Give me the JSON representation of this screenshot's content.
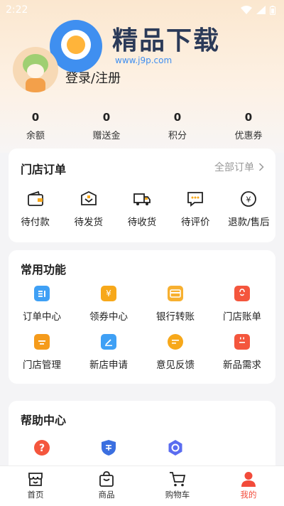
{
  "status_bar": {
    "time": "2:22"
  },
  "watermark": {
    "title": "精品下载",
    "url": "www.j9p.com"
  },
  "profile": {
    "login_label": "登录/注册"
  },
  "stats": [
    {
      "value": "0",
      "label": "余额"
    },
    {
      "value": "0",
      "label": "赠送金"
    },
    {
      "value": "0",
      "label": "积分"
    },
    {
      "value": "0",
      "label": "优惠券"
    }
  ],
  "orders": {
    "title": "门店订单",
    "view_all": "全部订单",
    "items": [
      {
        "label": "待付款",
        "icon": "wallet-icon"
      },
      {
        "label": "待发货",
        "icon": "package-icon"
      },
      {
        "label": "待收货",
        "icon": "truck-icon"
      },
      {
        "label": "待评价",
        "icon": "comment-icon"
      },
      {
        "label": "退款/售后",
        "icon": "refund-icon"
      }
    ]
  },
  "functions": {
    "title": "常用功能",
    "items": [
      {
        "label": "订单中心",
        "icon": "order-list-icon",
        "color": "#3fa0f5"
      },
      {
        "label": "领券中心",
        "icon": "coupon-icon",
        "color": "#f7a81a"
      },
      {
        "label": "银行转账",
        "icon": "bank-card-icon",
        "color": "#f7b030"
      },
      {
        "label": "门店账单",
        "icon": "shopping-bag-icon",
        "color": "#f4563d"
      },
      {
        "label": "门店管理",
        "icon": "store-icon",
        "color": "#f59b1b"
      },
      {
        "label": "新店申请",
        "icon": "edit-icon",
        "color": "#3fa0f5"
      },
      {
        "label": "意见反馈",
        "icon": "feedback-icon",
        "color": "#f7a81a"
      },
      {
        "label": "新品需求",
        "icon": "calendar-icon",
        "color": "#f4563d"
      }
    ]
  },
  "help": {
    "title": "帮助中心",
    "items": [
      {
        "icon": "question-icon",
        "color": "#f4563d"
      },
      {
        "icon": "after-sales-shield-icon",
        "color": "#3b6fe0"
      },
      {
        "icon": "service-icon",
        "color": "#5a6cf0"
      }
    ]
  },
  "tabbar": {
    "active_color": "#f24b3a",
    "tabs": [
      {
        "label": "首页",
        "icon": "home-store-icon"
      },
      {
        "label": "商品",
        "icon": "bag-icon"
      },
      {
        "label": "购物车",
        "icon": "cart-icon"
      },
      {
        "label": "我的",
        "icon": "person-icon"
      }
    ]
  }
}
